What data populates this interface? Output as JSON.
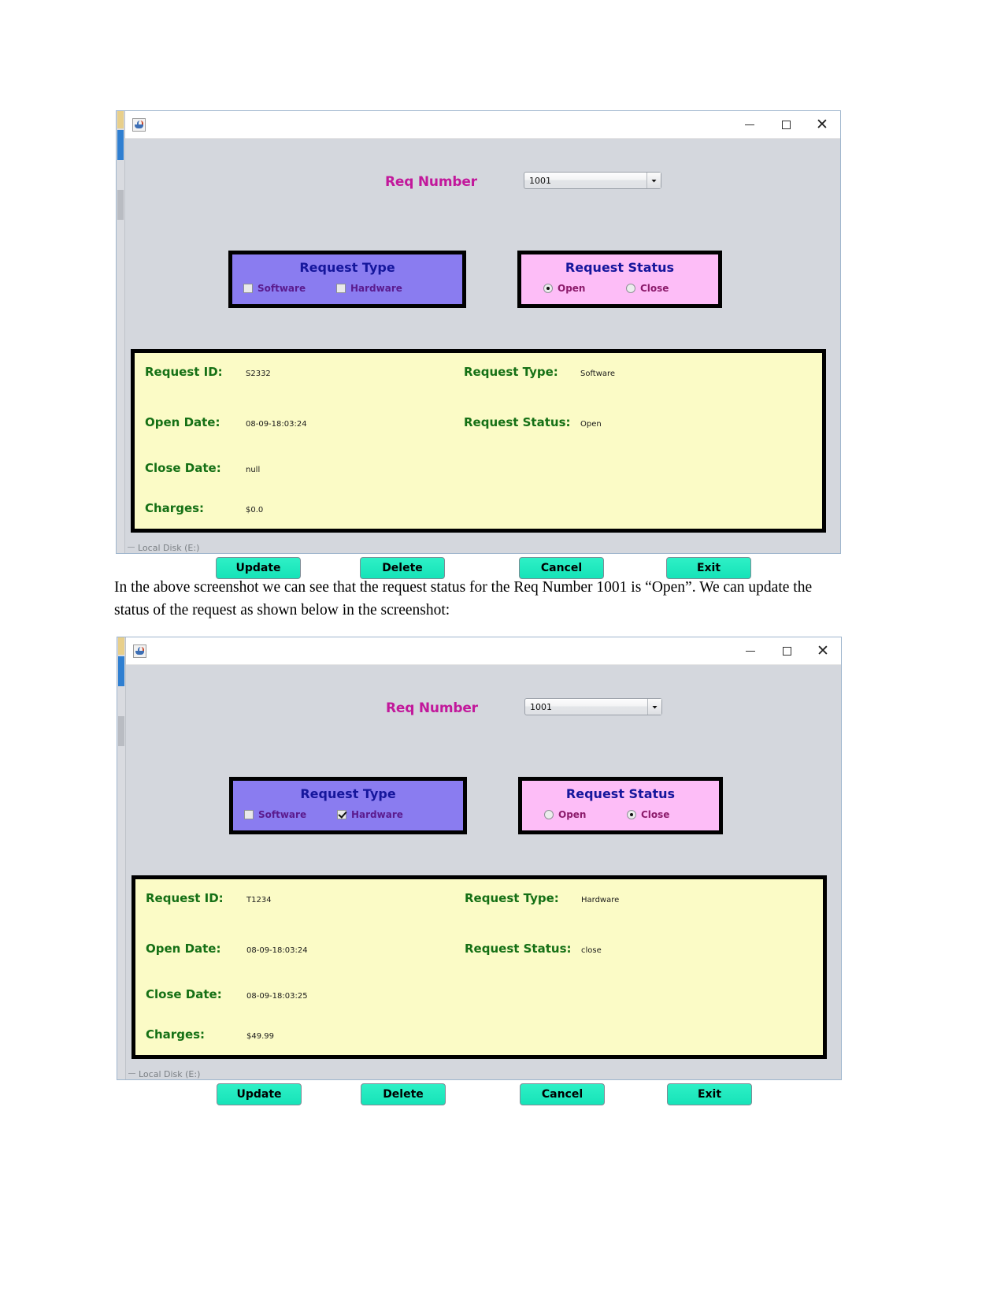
{
  "document": {
    "paragraph": "In the above screenshot we can see that the request status for the Req Number 1001 is “Open”. We can update the status of the request as shown below in the screenshot:"
  },
  "colors": {
    "accent_magenta": "#c2189b",
    "group_title_blue": "#15169c",
    "request_type_bg": "#8a7cf0",
    "request_status_bg": "#fdbdf7",
    "details_bg": "#fbfbc6",
    "detail_label_green": "#157015",
    "button_cyan": "#1fe8c0",
    "window_bg": "#d4d7dd"
  },
  "window_controls": {
    "minimize": "–",
    "maximize": "□",
    "close": "✕"
  },
  "desktop_clipped_text": "Local Disk (E:)",
  "windows": [
    {
      "id": "window-open-state",
      "app_icon": "java-coffee-cup-icon",
      "req_number": {
        "label": "Req Number",
        "value": "1001",
        "dropdown_icon": "chevron-down-icon"
      },
      "request_type": {
        "title": "Request Type",
        "options": [
          {
            "label": "Software",
            "checked": false
          },
          {
            "label": "Hardware",
            "checked": false
          }
        ]
      },
      "request_status": {
        "title": "Request Status",
        "options": [
          {
            "label": "Open",
            "selected": true
          },
          {
            "label": "Close",
            "selected": false
          }
        ]
      },
      "details": [
        {
          "label": "Request ID:",
          "value": "S2332"
        },
        {
          "label": "Request Type:",
          "value": "Software"
        },
        {
          "label": "Open Date:",
          "value": "08-09-18:03:24"
        },
        {
          "label": "Request Status:",
          "value": "Open"
        },
        {
          "label": "Close Date:",
          "value": "null"
        },
        {
          "label": "Charges:",
          "value": "$0.0"
        }
      ],
      "buttons": [
        "Update",
        "Delete",
        "Cancel",
        "Exit"
      ]
    },
    {
      "id": "window-closed-state",
      "app_icon": "java-coffee-cup-icon",
      "req_number": {
        "label": "Req Number",
        "value": "1001",
        "dropdown_icon": "chevron-down-icon"
      },
      "request_type": {
        "title": "Request Type",
        "options": [
          {
            "label": "Software",
            "checked": false
          },
          {
            "label": "Hardware",
            "checked": true
          }
        ]
      },
      "request_status": {
        "title": "Request Status",
        "options": [
          {
            "label": "Open",
            "selected": false
          },
          {
            "label": "Close",
            "selected": true
          }
        ]
      },
      "details": [
        {
          "label": "Request ID:",
          "value": "T1234"
        },
        {
          "label": "Request Type:",
          "value": "Hardware"
        },
        {
          "label": "Open Date:",
          "value": "08-09-18:03:24"
        },
        {
          "label": "Request Status:",
          "value": "close"
        },
        {
          "label": "Close Date:",
          "value": "08-09-18:03:25"
        },
        {
          "label": "Charges:",
          "value": "$49.99"
        }
      ],
      "buttons": [
        "Update",
        "Delete",
        "Cancel",
        "Exit"
      ]
    }
  ]
}
